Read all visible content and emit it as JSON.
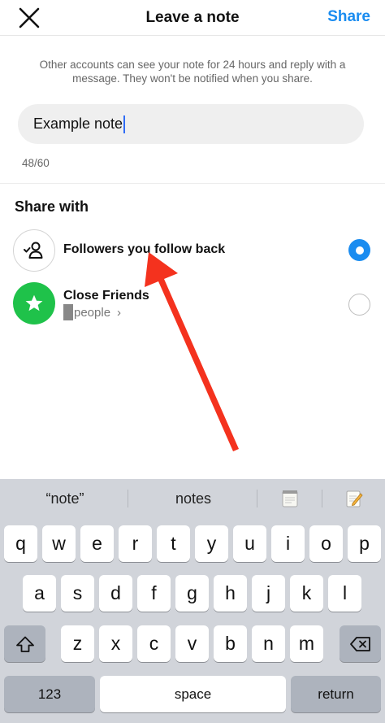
{
  "header": {
    "title": "Leave a note",
    "share_label": "Share",
    "close_icon": "close-icon"
  },
  "info_text": "Other accounts can see your note for 24 hours and reply with a message. They won't be notified when you share.",
  "note": {
    "value": "Example note",
    "counter": "48/60"
  },
  "share_with": {
    "title": "Share with",
    "options": [
      {
        "label": "Followers you follow back",
        "icon": "follow-back-icon",
        "selected": true
      },
      {
        "label": "Close Friends",
        "sub": "people",
        "icon": "star-icon",
        "selected": false
      }
    ]
  },
  "annotation": {
    "color": "#f4321e"
  },
  "keyboard": {
    "suggestions": [
      "“note”",
      "notes"
    ],
    "row1": [
      "q",
      "w",
      "e",
      "r",
      "t",
      "y",
      "u",
      "i",
      "o",
      "p"
    ],
    "row2": [
      "a",
      "s",
      "d",
      "f",
      "g",
      "h",
      "j",
      "k",
      "l"
    ],
    "row3": [
      "z",
      "x",
      "c",
      "v",
      "b",
      "n",
      "m"
    ],
    "numbers_label": "123",
    "space_label": "space",
    "return_label": "return",
    "shift_icon": "shift-icon",
    "delete_icon": "delete-icon"
  },
  "colors": {
    "accent": "#1a8cf0",
    "close_friends": "#1fc24a"
  }
}
